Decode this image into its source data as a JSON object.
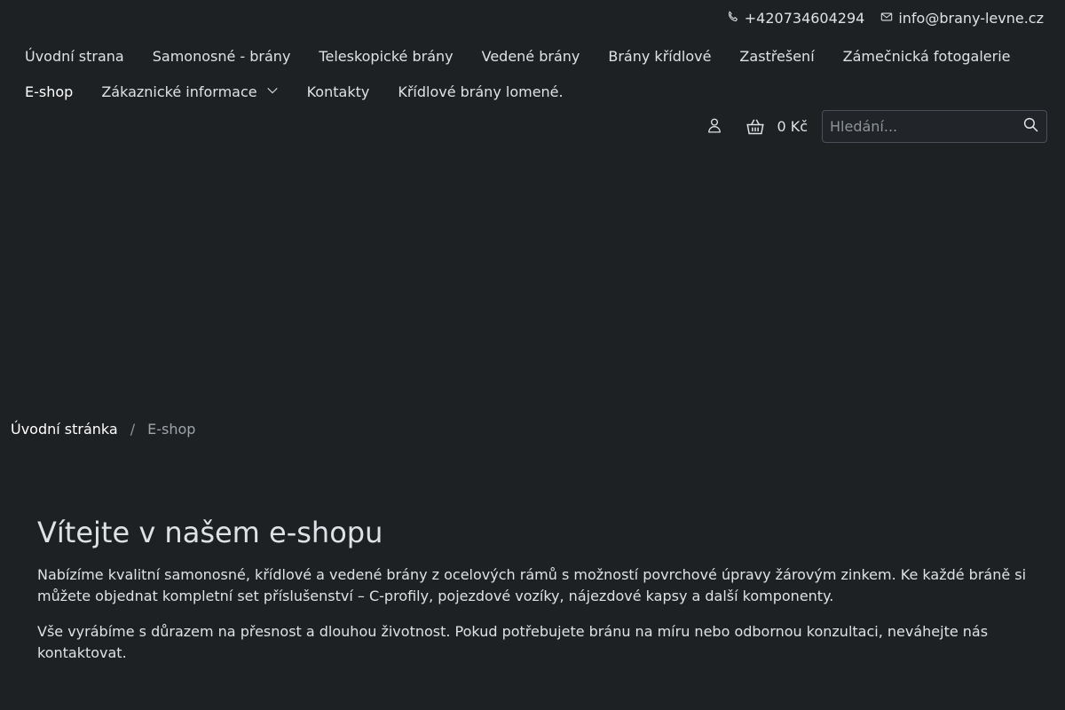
{
  "topbar": {
    "phone": "+420734604294",
    "email": "info@brany-levne.cz"
  },
  "nav": {
    "row1": [
      {
        "label": "Úvodní strana"
      },
      {
        "label": "Samonosné - brány"
      },
      {
        "label": "Teleskopické brány"
      },
      {
        "label": "Vedené brány"
      },
      {
        "label": "Brány křídlové"
      },
      {
        "label": "Zastřešení"
      },
      {
        "label": "Zámečnická fotogalerie"
      }
    ],
    "row2": [
      {
        "label": "E-shop",
        "active": true
      },
      {
        "label": "Zákaznické informace",
        "has_dropdown": true
      },
      {
        "label": "Kontakty"
      },
      {
        "label": "Křídlové brány lomené."
      }
    ]
  },
  "tools": {
    "cart_total": "0 Kč",
    "search_placeholder": "Hledání..."
  },
  "breadcrumb": {
    "home": "Úvodní stránka",
    "separator": "/",
    "current": "E-shop"
  },
  "content": {
    "title": "Vítejte v našem e-shopu",
    "paragraphs": [
      "Nabízíme kvalitní samonosné, křídlové a vedené brány z ocelových rámů s možností povrchové úpravy žárovým zinkem. Ke každé bráně si můžete objednat kompletní set příslušenství – C-profily, pojezdové vozíky, nájezdové kapsy a další komponenty.",
      "Vše vyrábíme s důrazem na přesnost a dlouhou životnost. Pokud potřebujete bránu na míru nebo odbornou konzultaci, neváhejte nás kontaktovat."
    ]
  },
  "colors": {
    "background": "#1e2124",
    "text": "#dee2e6",
    "muted": "#9ea5ab",
    "border": "#495057"
  }
}
